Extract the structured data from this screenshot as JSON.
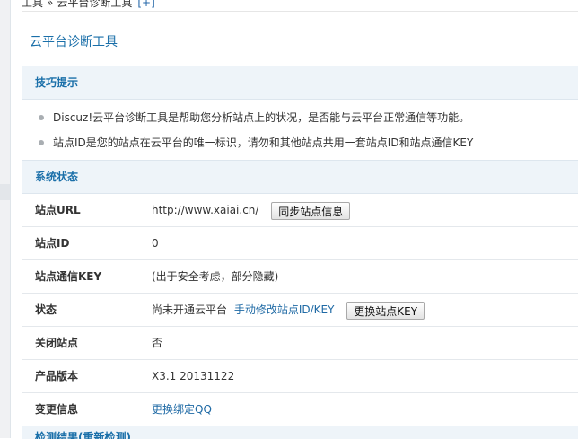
{
  "breadcrumb": {
    "root": "工具",
    "separator": "»",
    "current": "云平台诊断工具",
    "plus": "[+]"
  },
  "page_title": "云平台诊断工具",
  "tips": {
    "heading": "技巧提示",
    "items": [
      "Discuz!云平台诊断工具是帮助您分析站点上的状况，是否能与云平台正常通信等功能。",
      "站点ID是您的站点在云平台的唯一标识，请勿和其他站点共用一套站点ID和站点通信KEY"
    ]
  },
  "status": {
    "heading": "系统状态",
    "site_url": {
      "label": "站点URL",
      "value": "http://www.xaiai.cn/",
      "button": "同步站点信息"
    },
    "site_id": {
      "label": "站点ID",
      "value": "0"
    },
    "site_key": {
      "label": "站点通信KEY",
      "value": "(出于安全考虑，部分隐藏)"
    },
    "state": {
      "label": "状态",
      "value": "尚未开通云平台",
      "link": "手动修改站点ID/KEY",
      "button": "更换站点KEY"
    },
    "closed": {
      "label": "关闭站点",
      "value": "否"
    },
    "version": {
      "label": "产品版本",
      "value": "X3.1 20131122"
    },
    "change": {
      "label": "变更信息",
      "link": "更换绑定QQ"
    }
  },
  "results": {
    "heading": "检测结果(重新检测)"
  },
  "colors": {
    "accent": "#1a6fa9",
    "section_bg": "#eef4f9",
    "link": "#1f6aa5"
  }
}
